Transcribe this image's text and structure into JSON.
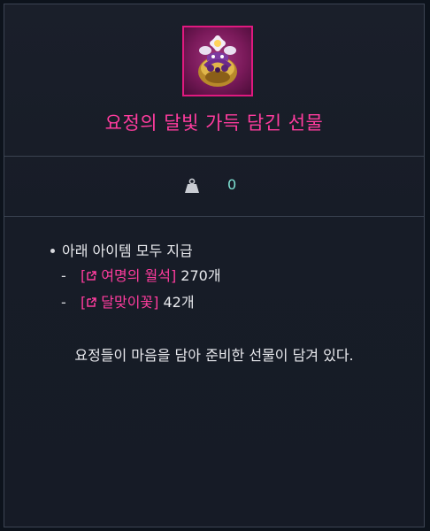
{
  "item": {
    "title": "요정의 달빛 가득 담긴 선물",
    "icon": "flower-pot-gift-icon",
    "title_color": "#ff3c9e",
    "frame_color": "#e0197f"
  },
  "weight": {
    "icon": "weight-icon",
    "value": "0"
  },
  "contents": {
    "header": "아래 아이템 모두 지급",
    "items": [
      {
        "link_label": "[  여명의 월석]",
        "name": "여명의 월석",
        "count": "270개"
      },
      {
        "link_label": "[  달맞이꽃]",
        "name": "달맞이꽃",
        "count": "42개"
      }
    ],
    "dash": "-"
  },
  "description": "요정들이 마음을 담아 준비한 선물이 담겨 있다."
}
